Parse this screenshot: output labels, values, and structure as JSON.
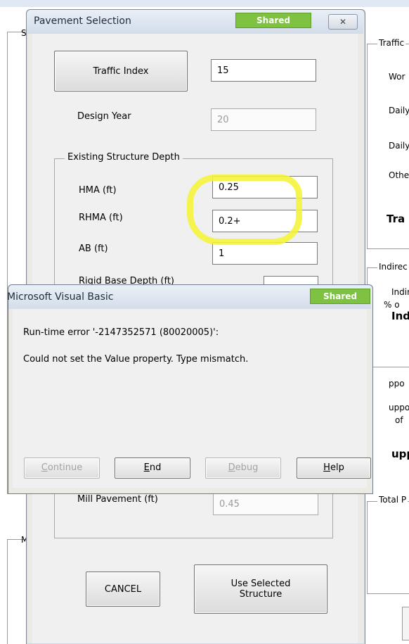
{
  "background_sheet": {
    "left_labels": [
      "S",
      "M"
    ],
    "traffic_label": "Traffic",
    "rows": [
      "Wor",
      "Daily",
      "Daily",
      "Othe"
    ],
    "traffic_bold": "Tra",
    "indirect_label": "Indirec",
    "indirect_sub1": "Indir",
    "indirect_sub2": "% o",
    "ind_bold": "Ind",
    "support_1": "ppo",
    "support_2": "uppo",
    "support_3": "of",
    "support_bold": "upp",
    "total_label": "Total P"
  },
  "pavement_window": {
    "title": "Pavement Selection",
    "badge": "Shared",
    "close_glyph": "✕",
    "traffic_index_button": "Traffic Index",
    "traffic_index_value": "15",
    "design_year_label": "Design Year",
    "design_year_value": "20",
    "group_label": "Existing Structure Depth",
    "hma_label": "HMA (ft)",
    "hma_value": "0.25",
    "rhma_label": "RHMA (ft)",
    "rhma_value": "0.2+",
    "ab_label": "AB (ft)",
    "ab_value": "1",
    "rigid_label": "Rigid Base Depth (ft)",
    "mill_label": "Mill Pavement (ft)",
    "mill_value": "0.45",
    "cancel_button": "CANCEL",
    "use_selected_line1": "Use Selected",
    "use_selected_line2": "Structure"
  },
  "vb_dialog": {
    "title": "Microsoft Visual Basic",
    "badge": "Shared",
    "error_line": "Run-time error '-2147352571 (80020005)':",
    "message": "Could not set the Value property. Type mismatch.",
    "buttons": {
      "continue_first": "C",
      "continue_rest": "ontinue",
      "end_first": "E",
      "end_rest": "nd",
      "debug_first": "D",
      "debug_rest": "ebug",
      "help_first": "H",
      "help_rest": "elp"
    }
  },
  "colors": {
    "badge_green": "#7fc241",
    "highlight_yellow": "#f5f235"
  }
}
